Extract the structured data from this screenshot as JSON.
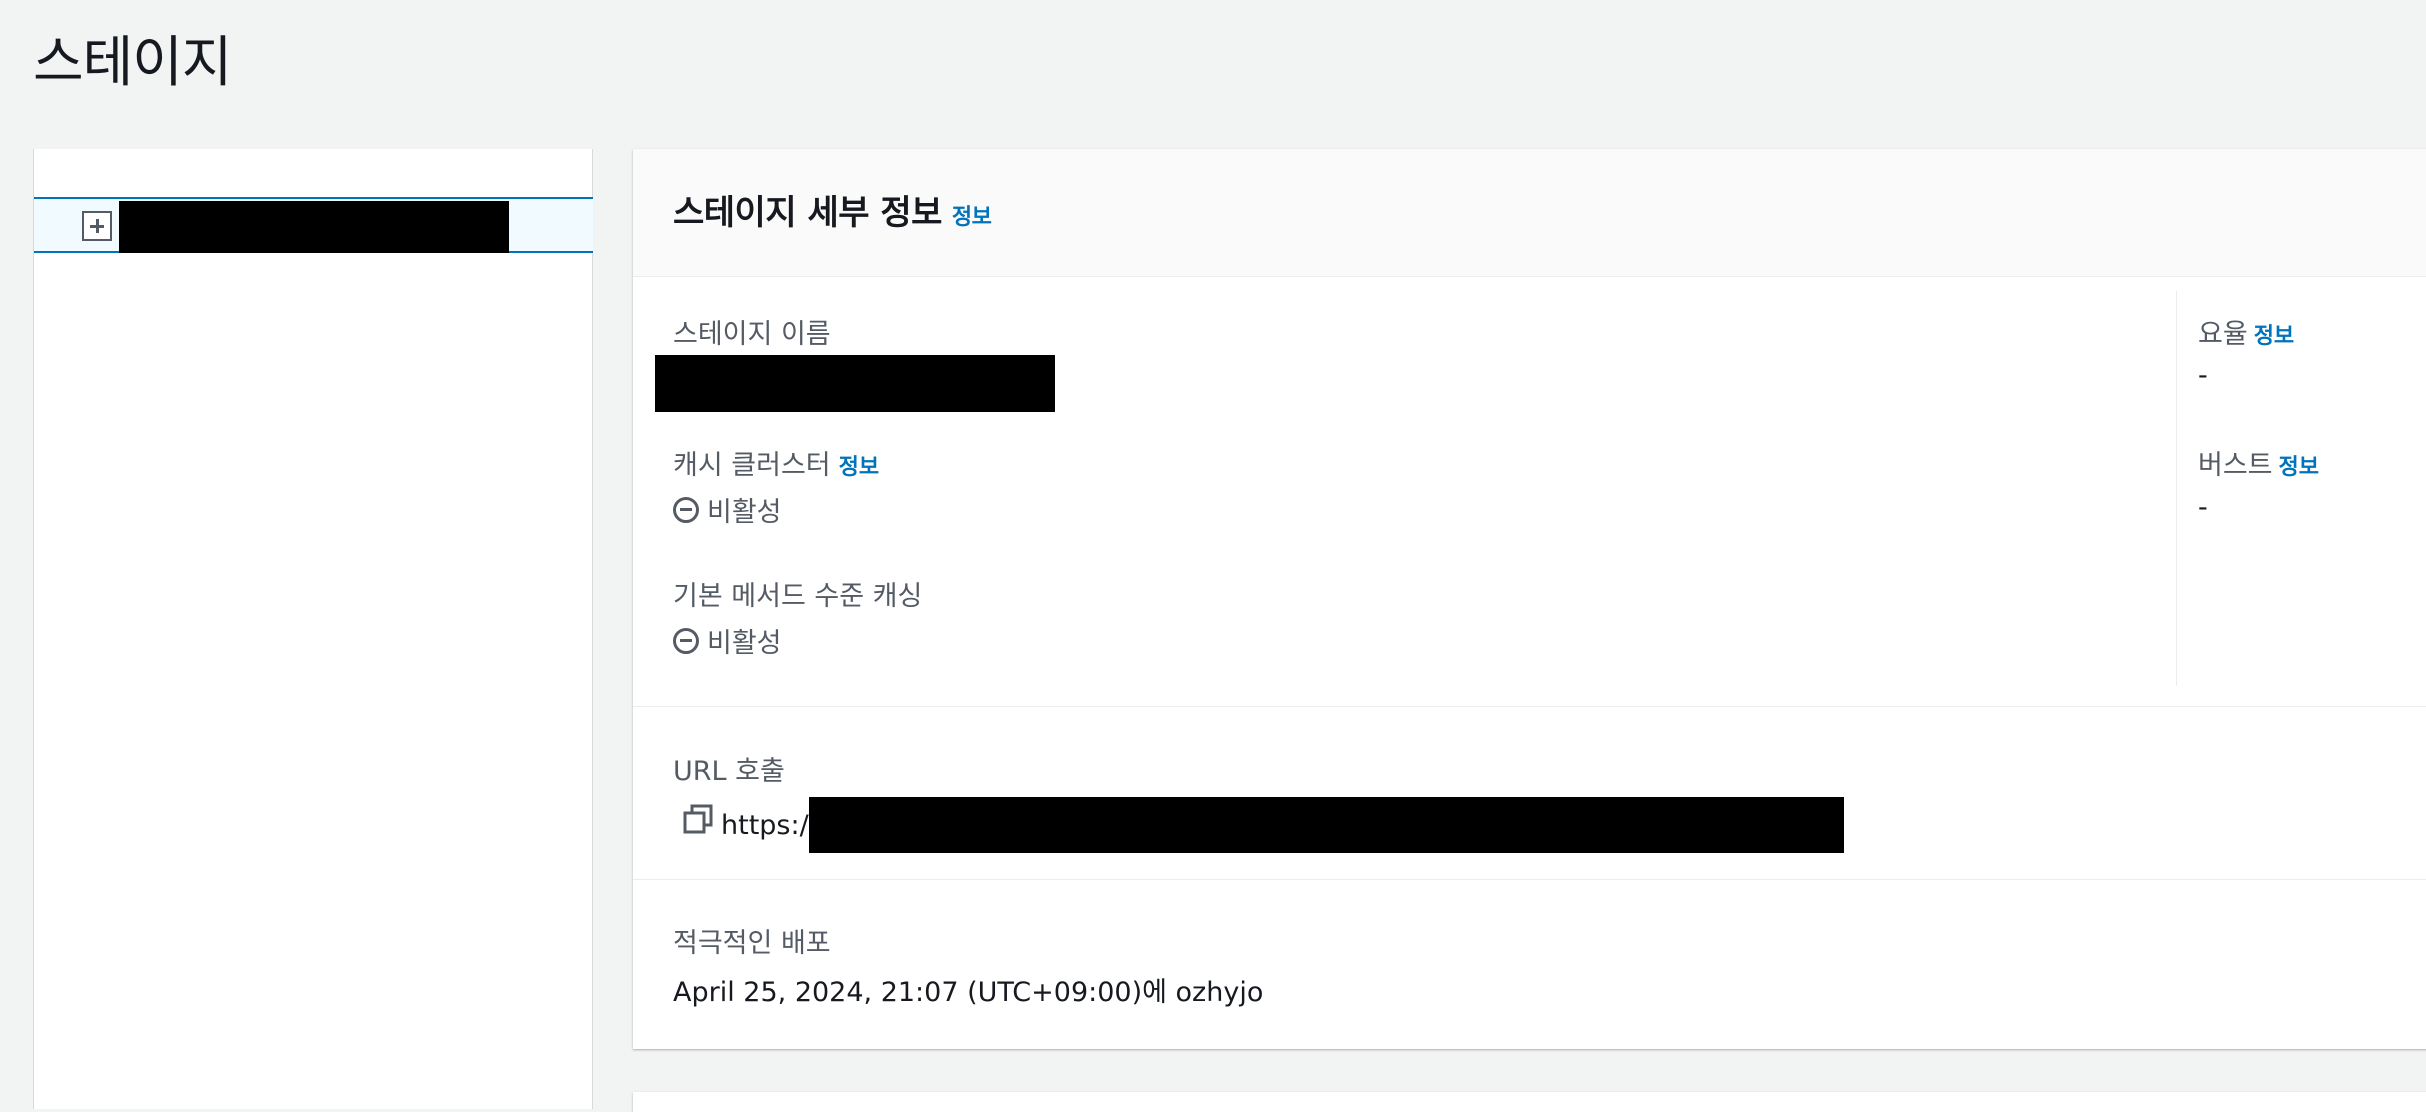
{
  "page": {
    "title": "스테이지"
  },
  "tree": {
    "expand_icon": "plus-square-icon"
  },
  "details": {
    "title": "스테이지 세부 정보",
    "info": "정보",
    "stage_name_label": "스테이지 이름",
    "cache_cluster_label": "캐시 클러스터",
    "cache_cluster_info": "정보",
    "cache_cluster_status": "비활성",
    "method_cache_label": "기본 메서드 수준 캐싱",
    "method_cache_status": "비활성",
    "rate_label": "요율",
    "rate_info": "정보",
    "rate_value": "-",
    "burst_label": "버스트",
    "burst_info": "정보",
    "burst_value": "-",
    "invoke_url_label": "URL 호출",
    "invoke_url_prefix": "https:/",
    "active_deployment_label": "적극적인 배포",
    "active_deployment_value": "April 25, 2024, 21:07 (UTC+09:00)에 ozhyjo"
  },
  "colors": {
    "link": "#0073bb",
    "selected_border": "#0073bb",
    "selected_bg": "#f1faff"
  }
}
